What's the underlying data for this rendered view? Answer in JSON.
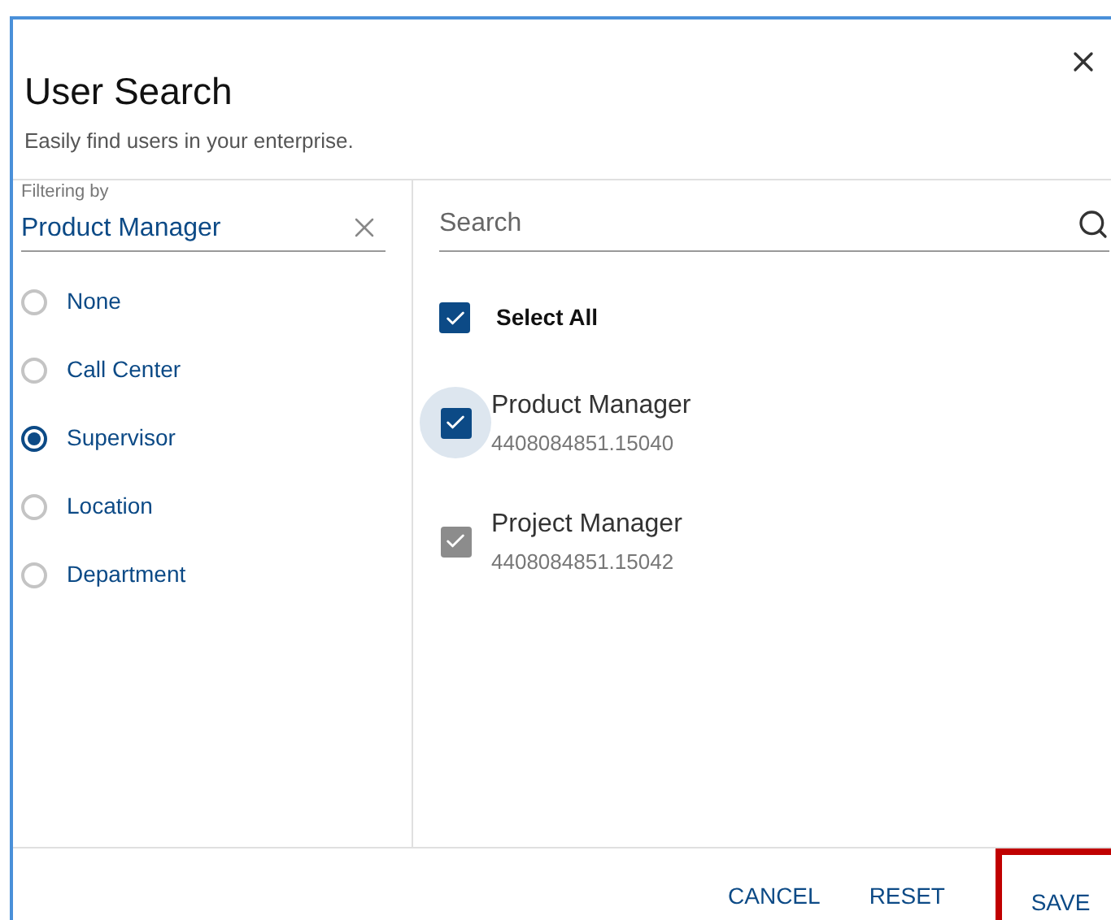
{
  "dialog": {
    "title": "User Search",
    "subtitle": "Easily find users in your enterprise."
  },
  "filter": {
    "label": "Filtering by",
    "value": "Product Manager"
  },
  "filter_options": [
    {
      "label": "None",
      "selected": false
    },
    {
      "label": "Call Center",
      "selected": false
    },
    {
      "label": "Supervisor",
      "selected": true
    },
    {
      "label": "Location",
      "selected": false
    },
    {
      "label": "Department",
      "selected": false
    }
  ],
  "search": {
    "placeholder": "Search"
  },
  "select_all": {
    "label": "Select All",
    "checked": true
  },
  "users": [
    {
      "name": "Product Manager",
      "id": "4408084851.15040",
      "checked": true,
      "disabled": false,
      "focused": true
    },
    {
      "name": "Project Manager",
      "id": "4408084851.15042",
      "checked": true,
      "disabled": true,
      "focused": false
    }
  ],
  "buttons": [
    {
      "label": "CANCEL",
      "highlighted": false
    },
    {
      "label": "RESET",
      "highlighted": false
    },
    {
      "label": "SAVE",
      "highlighted": true
    }
  ]
}
